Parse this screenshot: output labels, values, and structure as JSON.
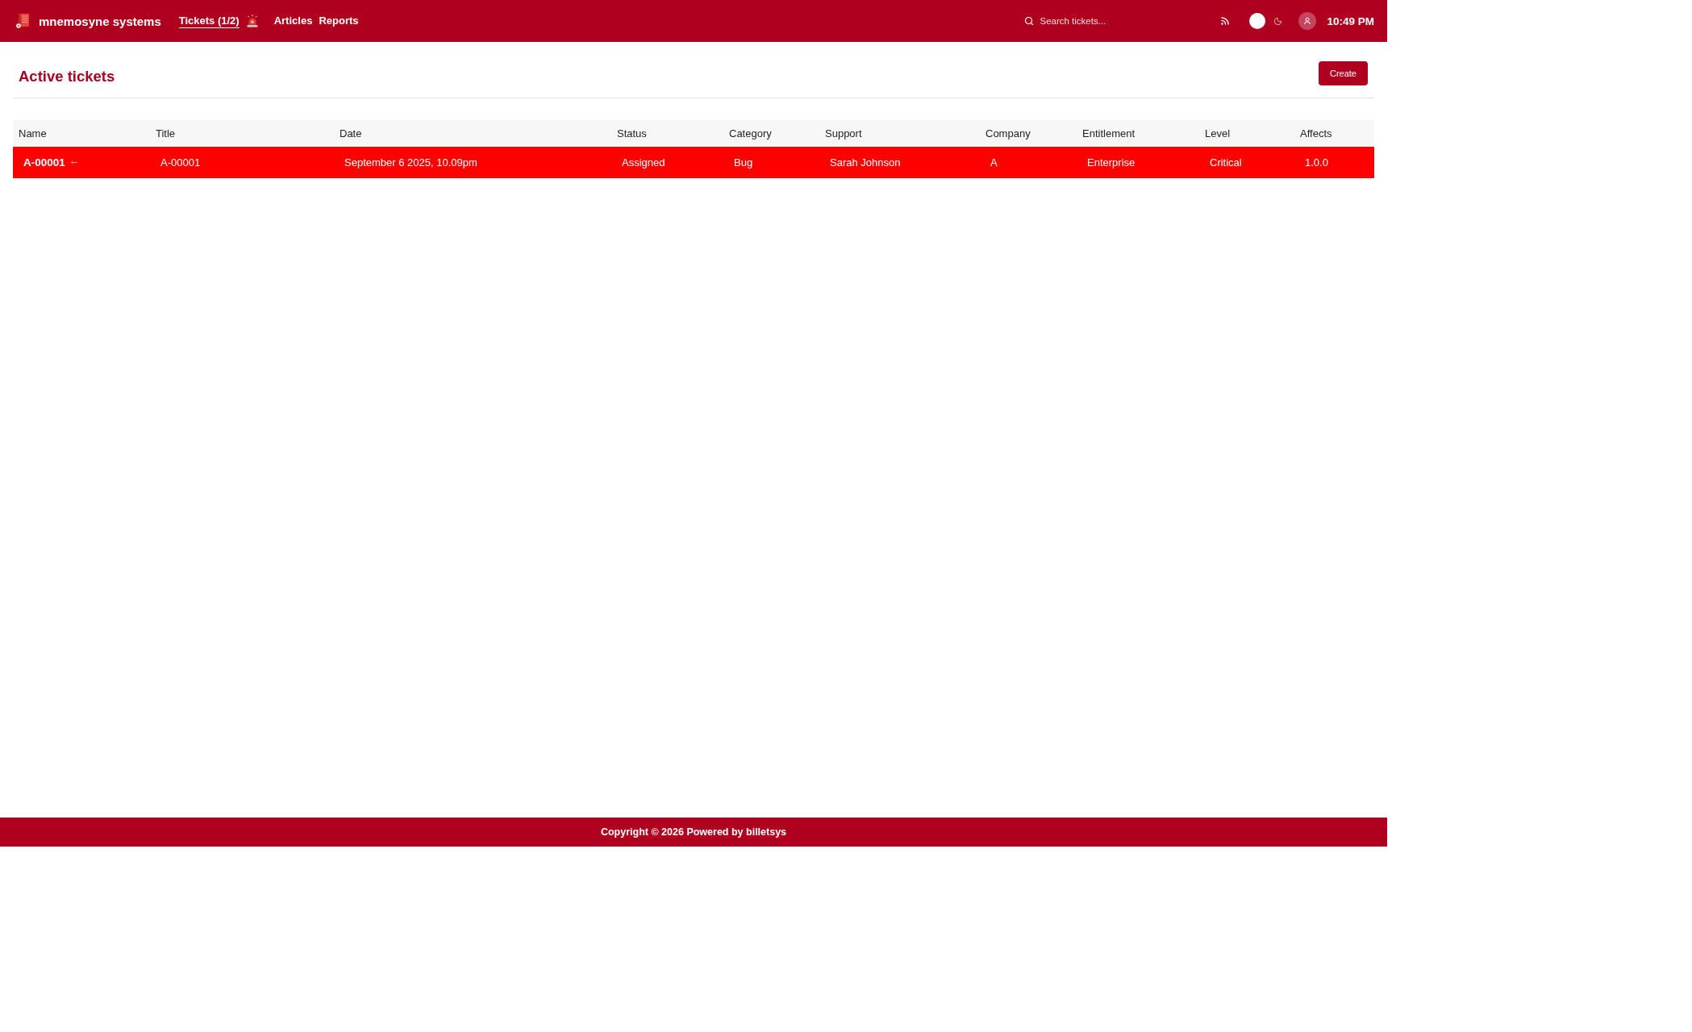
{
  "header": {
    "brand": "mnemosyne systems",
    "nav": [
      {
        "label": "Tickets (1/2)",
        "selected": true,
        "alert": true
      },
      {
        "label": "Articles",
        "selected": false,
        "alert": false
      },
      {
        "label": "Reports",
        "selected": false,
        "alert": false
      }
    ],
    "search": {
      "placeholder": "Search tickets..."
    },
    "theme_toggle": {
      "dark": false
    },
    "time": "10:49 PM"
  },
  "page": {
    "title": "Active tickets",
    "create_button": "Create"
  },
  "table": {
    "columns": [
      "Name",
      "Title",
      "Date",
      "Status",
      "Category",
      "Support",
      "Company",
      "Entitlement",
      "Level",
      "Affects"
    ],
    "rows": [
      {
        "highlighted": true,
        "cells": [
          "A-00001",
          "A-00001",
          "September 6 2025, 10.09pm",
          "Assigned",
          "Bug",
          "Sarah Johnson",
          "A",
          "Enterprise",
          "Critical",
          "1.0.0"
        ]
      }
    ]
  },
  "footer": {
    "text": "Copyright © 2026 Powered by billetsys"
  }
}
